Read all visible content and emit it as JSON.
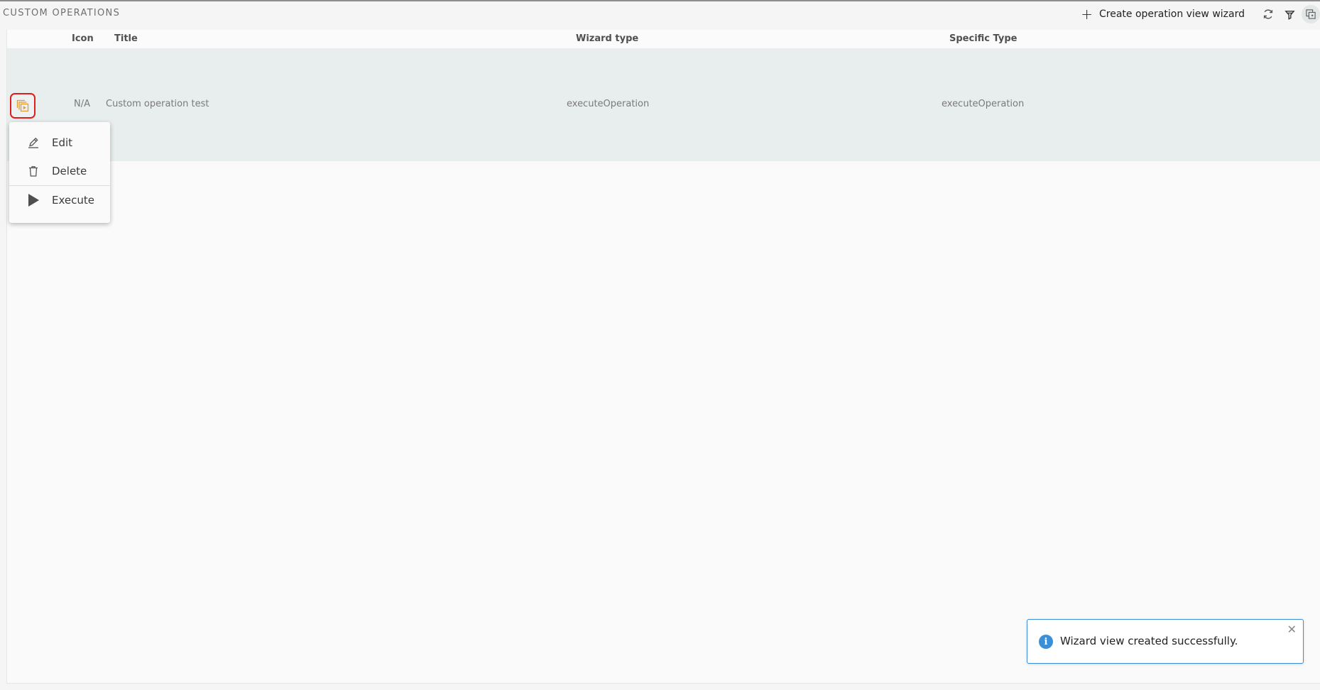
{
  "page": {
    "title": "CUSTOM OPERATIONS"
  },
  "toolbar": {
    "create_label": "Create operation view wizard",
    "icons": [
      "plus-icon",
      "refresh-icon",
      "filter-icon",
      "wizard-view-icon"
    ]
  },
  "table": {
    "columns": [
      "Icon",
      "Title",
      "Wizard type",
      "Specific Type"
    ],
    "rows": [
      {
        "icon": "N/A",
        "title": "Custom operation test",
        "wizard_type": "executeOperation",
        "specific_type": "executeOperation"
      }
    ]
  },
  "context_menu": {
    "items": [
      {
        "label": "Edit",
        "icon": "pencil-icon"
      },
      {
        "label": "Delete",
        "icon": "trash-icon"
      },
      {
        "label": "Execute",
        "icon": "play-icon"
      }
    ]
  },
  "toast": {
    "message": "Wizard view created successfully.",
    "icon": "info-icon"
  },
  "colors": {
    "accent": "#e59a2c",
    "highlight_border": "#e01e1e",
    "toast_border": "#3d8fd6",
    "row_bg": "#e8eded"
  }
}
